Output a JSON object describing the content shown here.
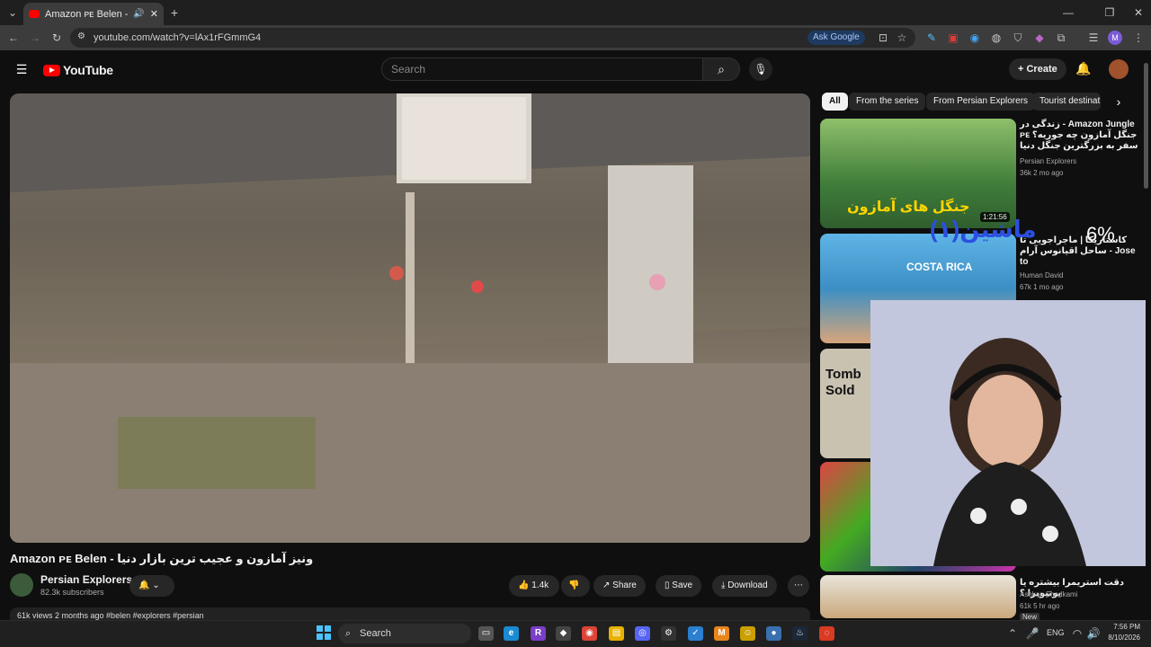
{
  "browser": {
    "tab_title": "Amazon ᴘᴇ Belen - بازار دنیا",
    "url": "youtube.com/watch?v=lAx1rFGmmG4",
    "ask_google": "Ask Google"
  },
  "youtube": {
    "logo": "YouTube",
    "search_placeholder": "Search",
    "create_label": "Create"
  },
  "video": {
    "title": "Amazon ᴘᴇ Belen - ونیز آمازون و عجیب ترین بازار دنیا",
    "channel": "Persian Explorers",
    "subscribers": "82.3k subscribers",
    "likes": "1.4k",
    "share": "Share",
    "save": "Save",
    "download": "Download",
    "meta": "61k views  2 months ago  #belen #explorers #persian"
  },
  "chips": [
    "All",
    "From the series",
    "From Persian Explorers",
    "Tourist destinat"
  ],
  "recommendations": [
    {
      "title": "زندگی در - Amazon Jungle ᴘᴇ جنگل آمازون چه جوریه؟ سفر به بزرگترین جنگل دنیا",
      "channel": "Persian Explorers",
      "meta": "36k  2 mo ago",
      "duration": "1:21:56",
      "thumb_caption": "جنگل های آمازون"
    },
    {
      "title": "کاستاریکا | ماجراجویی تا ساحل اقیانوس آرام - Jose to",
      "channel": "Human David",
      "meta": "67k  1 mo ago",
      "thumb_caption": "COSTA RICA"
    },
    {
      "title": "",
      "channel": "",
      "meta": "",
      "thumb_caption": "Tomb Sold"
    },
    {
      "title": "",
      "channel": "",
      "meta": "",
      "thumb_caption": ""
    },
    {
      "title": "دقت استریمرا بیشتره یا یوتیوبرا ؟",
      "channel": "Ashkan Shadkami",
      "meta": "61k  5 hr ago",
      "badge": "New"
    }
  ],
  "overlay": {
    "percent": "6%",
    "text": "ماشین(۱)"
  },
  "taskbar": {
    "search": "Search",
    "lang": "ENG",
    "time": "7:56 PM",
    "date": "8/10/2026"
  }
}
